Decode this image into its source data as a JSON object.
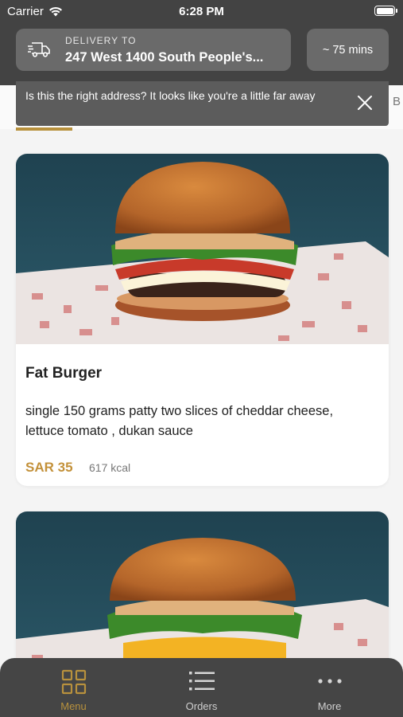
{
  "status_bar": {
    "carrier": "Carrier",
    "time": "6:28 PM"
  },
  "header": {
    "delivery_label": "DELIVERY TO",
    "address": "247 West 1400 South People's...",
    "eta": "~ 75 mins"
  },
  "tabs": {
    "peek_label": "B"
  },
  "banner": {
    "message": "Is this the right address? It looks like you're a little far away"
  },
  "menu_items": [
    {
      "title": "Fat Burger",
      "description": "single 150 grams patty two slices of cheddar cheese, lettuce tomato , dukan sauce",
      "price": "SAR 35",
      "kcal": "617 kcal"
    },
    {
      "title": "",
      "description": "",
      "price": "",
      "kcal": ""
    }
  ],
  "bottom_nav": [
    {
      "label": "Menu",
      "icon": "grid-icon",
      "active": true
    },
    {
      "label": "Orders",
      "icon": "list-icon",
      "active": false
    },
    {
      "label": "More",
      "icon": "more-dots-icon",
      "active": false
    }
  ],
  "colors": {
    "accent": "#b8913d",
    "header_bg": "#434343",
    "price": "#c3913a"
  }
}
